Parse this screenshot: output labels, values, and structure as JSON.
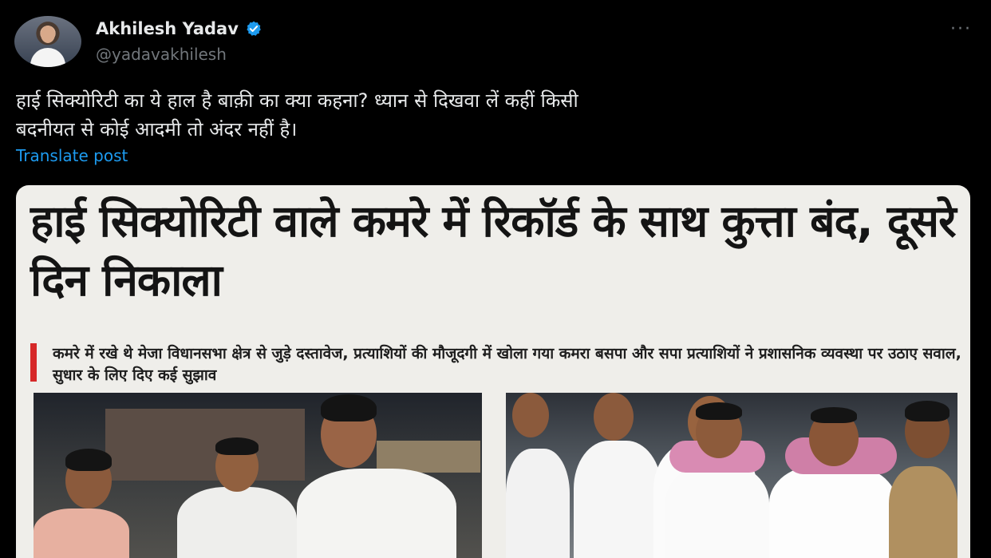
{
  "post": {
    "author_name": "Akhilesh Yadav",
    "handle": "@yadavakhilesh",
    "more_label": "···",
    "text": "हाई सिक्योरिटी का ये हाल है बाक़ी का क्या कहना? ध्यान से दिखवा लें कहीं किसी\nबदनीयत से कोई आदमी तो अंदर नहीं है।",
    "translate_label": "Translate post",
    "verified_icon": "verified-badge-icon",
    "accent_color": "#1d9bf0"
  },
  "newspaper": {
    "headline": "हाई सिक्योरिटी वाले कमरे में रिकॉर्ड के साथ कुत्ता बंद, दूसरे दिन निकाला",
    "subheadline": "कमरे में रखे थे मेजा विधानसभा क्षेत्र से जुड़े दस्तावेज, प्रत्याशियों की मौजूदगी में खोला गया कमरा बसपा और सपा प्रत्याशियों ने प्रशासनिक व्यवस्था पर उठाए सवाल, सुधार के लिए दिए कई सुझाव"
  }
}
